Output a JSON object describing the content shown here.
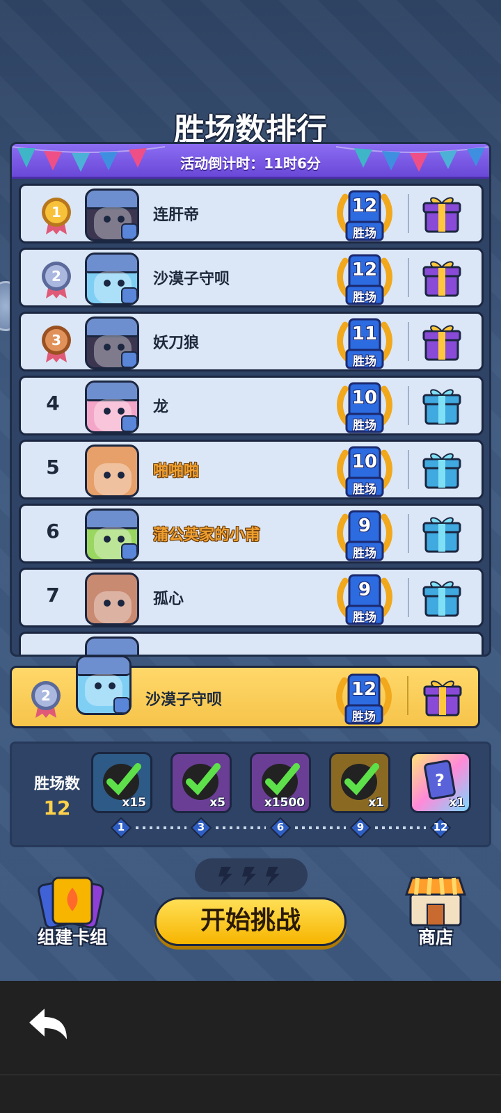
{
  "header": {
    "title": "胜场数排行",
    "countdown": "活动倒计时：11时6分"
  },
  "leaderboard": [
    {
      "rank": "1",
      "name": "连肝帝",
      "wins": "12",
      "wins_label": "胜场",
      "name_style": "normal",
      "avatar": "dark-hood",
      "gift": "purple"
    },
    {
      "rank": "2",
      "name": "沙漠子守呗",
      "wins": "12",
      "wins_label": "胜场",
      "name_style": "normal",
      "avatar": "blue-hood",
      "gift": "purple"
    },
    {
      "rank": "3",
      "name": "妖刀狼",
      "wins": "11",
      "wins_label": "胜场",
      "name_style": "normal",
      "avatar": "dark-hood",
      "gift": "purple"
    },
    {
      "rank": "4",
      "name": "龙",
      "wins": "10",
      "wins_label": "胜场",
      "name_style": "normal",
      "avatar": "pink-hood",
      "gift": "blue"
    },
    {
      "rank": "5",
      "name": "啪啪啪",
      "wins": "10",
      "wins_label": "胜场",
      "name_style": "gold",
      "avatar": "orange",
      "gift": "blue"
    },
    {
      "rank": "6",
      "name": "蒲公英家的小甫",
      "wins": "9",
      "wins_label": "胜场",
      "name_style": "gold",
      "avatar": "green-hood",
      "gift": "blue"
    },
    {
      "rank": "7",
      "name": "孤心",
      "wins": "9",
      "wins_label": "胜场",
      "name_style": "normal",
      "avatar": "masked",
      "gift": "blue"
    }
  ],
  "my_entry": {
    "rank": "2",
    "name": "沙漠子守呗",
    "wins": "12",
    "wins_label": "胜场"
  },
  "progress": {
    "label": "胜场数",
    "value": "12",
    "tiers": [
      {
        "count": "x15",
        "color": "#2d5a86",
        "claimed": true
      },
      {
        "count": "x5",
        "color": "#6b3e96",
        "claimed": true
      },
      {
        "count": "x1500",
        "color": "#6b3e96",
        "claimed": true
      },
      {
        "count": "x1",
        "color": "#8a6a22",
        "claimed": true
      },
      {
        "count": "x1",
        "color": "#b8d8ff",
        "claimed": false
      }
    ],
    "milestones": [
      "1",
      "3",
      "6",
      "9",
      "12"
    ]
  },
  "actions": {
    "deck_label": "组建卡组",
    "start_label": "开始挑战",
    "shop_label": "商店"
  },
  "colors": {
    "accent": "#f7b500",
    "purple_bar": "#7a5ae6",
    "row_bg": "#dbe7f7",
    "highlight": "#f6c44a"
  }
}
